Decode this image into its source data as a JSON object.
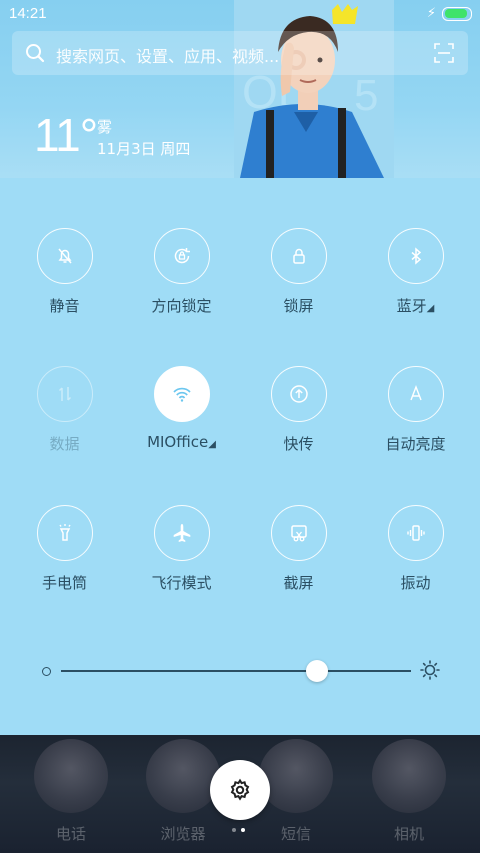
{
  "status_bar": {
    "time": "14:21",
    "battery_level": 0.95
  },
  "search": {
    "placeholder": "搜索网页、设置、应用、视频..."
  },
  "weather": {
    "temperature": "11°",
    "condition": "雾",
    "date": "11月3日 周四"
  },
  "toggles": [
    {
      "label": "静音",
      "icon": "silent-bell-icon",
      "state": "off"
    },
    {
      "label": "方向锁定",
      "icon": "rotation-lock-icon",
      "state": "off"
    },
    {
      "label": "锁屏",
      "icon": "lock-icon",
      "state": "off"
    },
    {
      "label": "蓝牙",
      "icon": "bluetooth-icon",
      "state": "off",
      "has_submenu": true
    },
    {
      "label": "数据",
      "icon": "mobile-data-icon",
      "state": "disabled"
    },
    {
      "label": "MIOffice",
      "icon": "wifi-icon",
      "state": "on",
      "has_submenu": true
    },
    {
      "label": "快传",
      "icon": "quick-transfer-icon",
      "state": "off"
    },
    {
      "label": "自动亮度",
      "icon": "auto-brightness-icon",
      "state": "off"
    },
    {
      "label": "手电筒",
      "icon": "flashlight-icon",
      "state": "off"
    },
    {
      "label": "飞行模式",
      "icon": "airplane-icon",
      "state": "off"
    },
    {
      "label": "截屏",
      "icon": "screenshot-icon",
      "state": "off"
    },
    {
      "label": "振动",
      "icon": "vibrate-icon",
      "state": "off"
    }
  ],
  "submenu_marker": "◢",
  "brightness": {
    "level": 0.73
  },
  "dock": {
    "apps": [
      {
        "label": "电话"
      },
      {
        "label": "浏览器"
      },
      {
        "label": "短信"
      },
      {
        "label": "相机"
      }
    ],
    "page_count": 2,
    "current_page": 1
  },
  "colors": {
    "panel_bg": "#9fdcf6",
    "label_text": "#2b4f63",
    "battery": "#3fe36a"
  }
}
